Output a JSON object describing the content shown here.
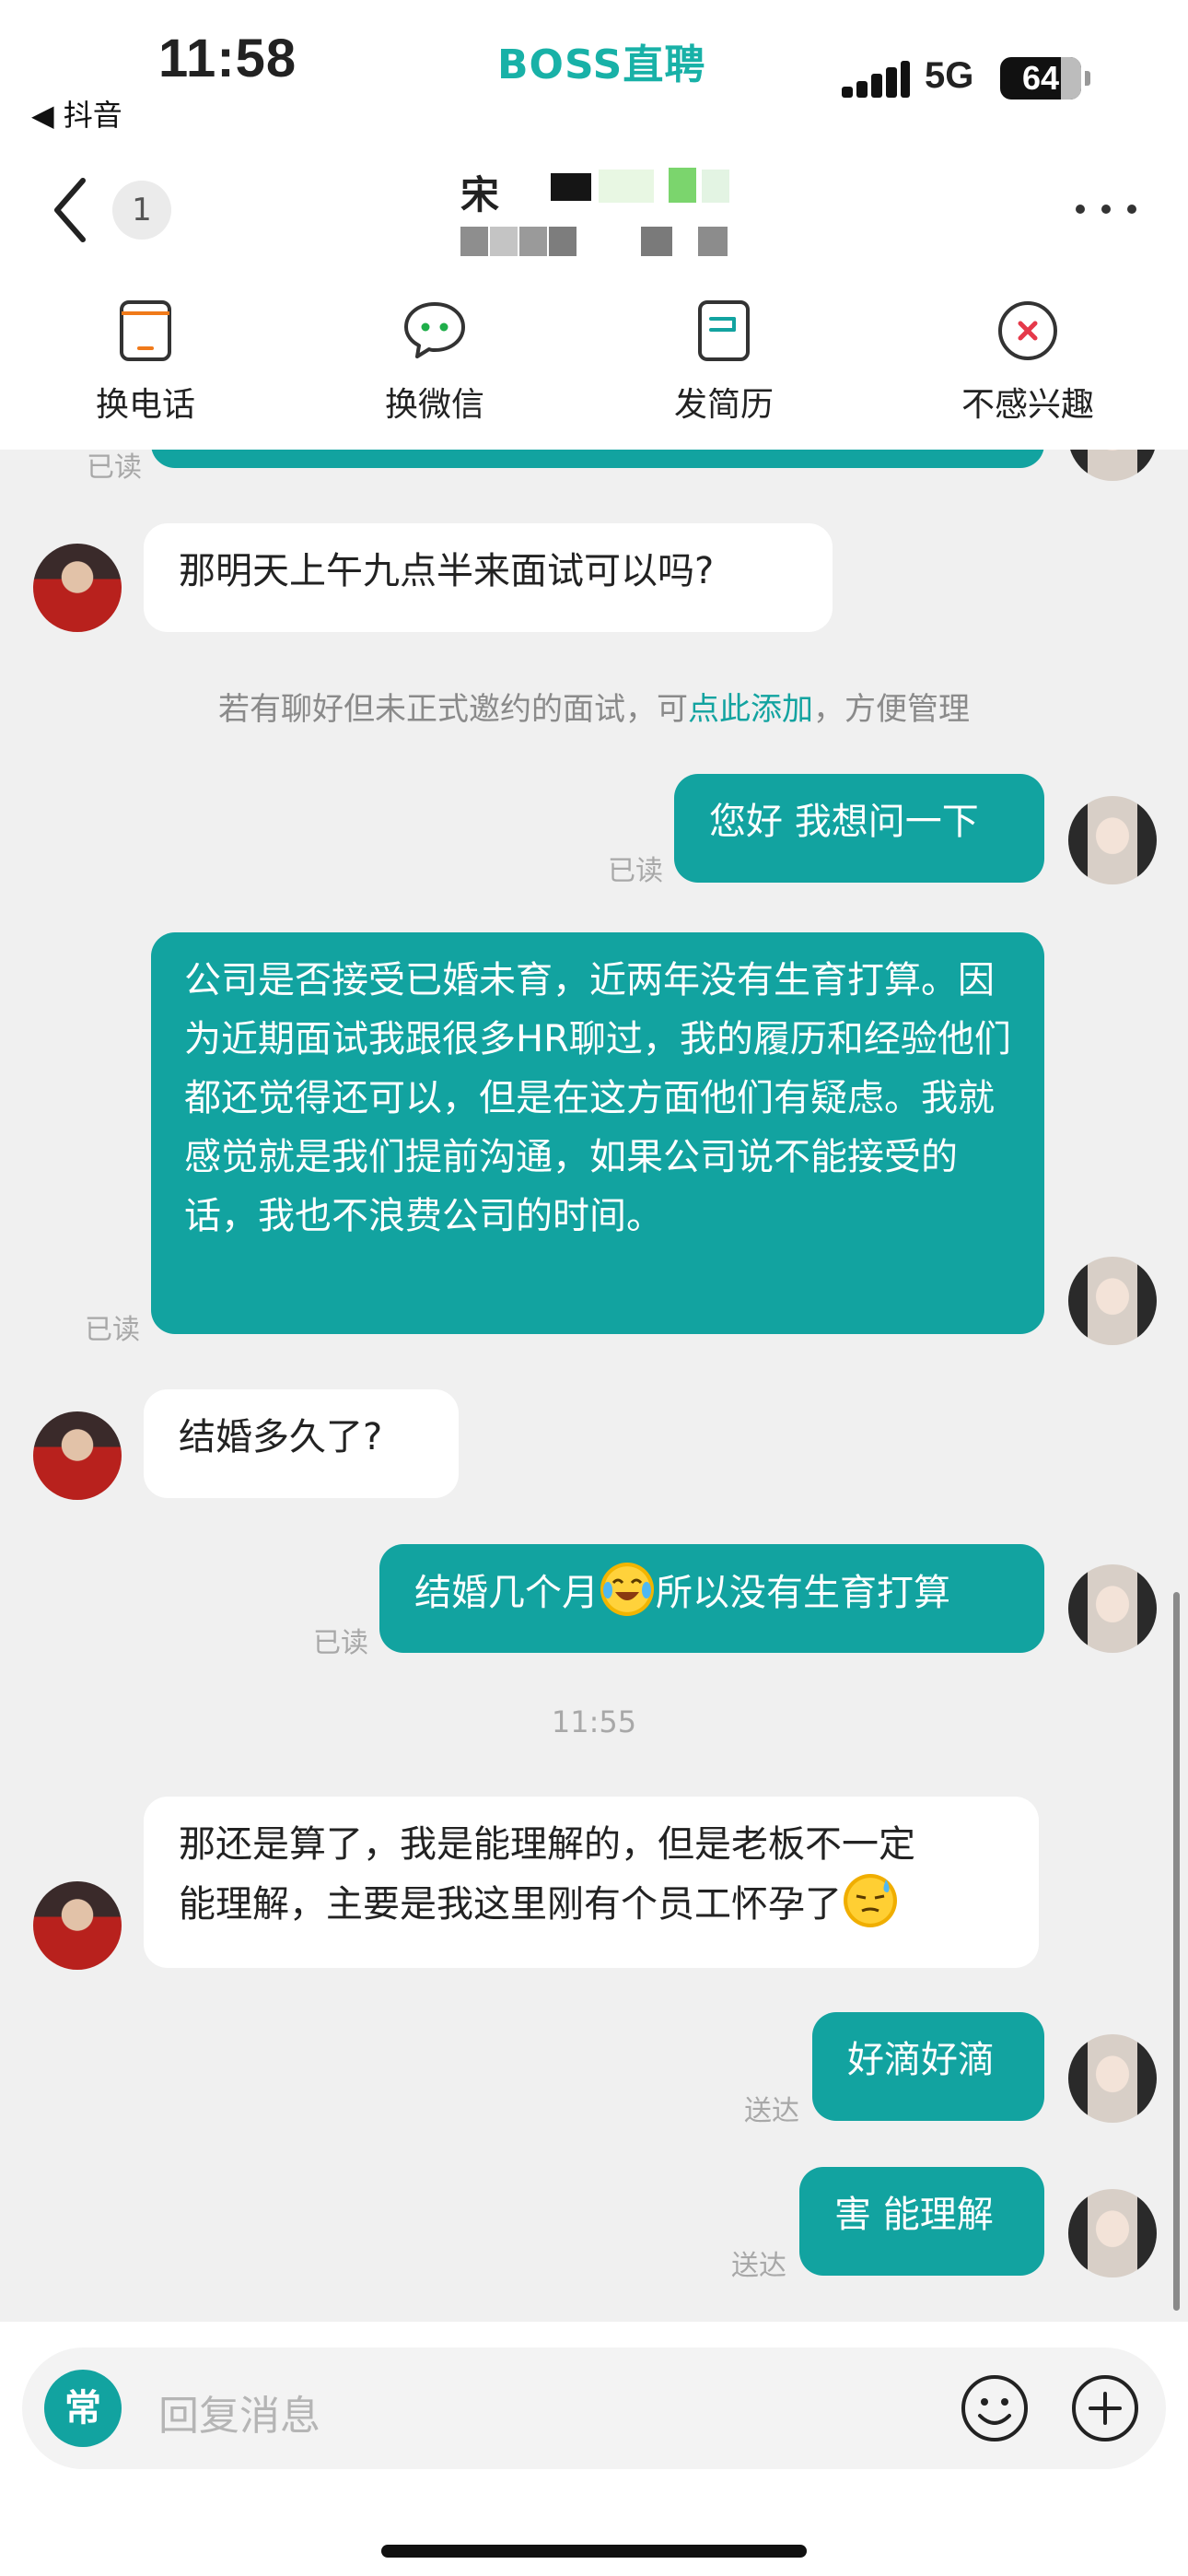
{
  "status_bar": {
    "time": "11:58",
    "back_app": "◀ 抖音",
    "app_logo": "BOSS直聘",
    "network": "5G",
    "battery": "64"
  },
  "header": {
    "unread_count": "1",
    "title_visible": "宋"
  },
  "actions": [
    {
      "label": "换电话",
      "icon": "phone-icon"
    },
    {
      "label": "换微信",
      "icon": "wechat-icon"
    },
    {
      "label": "发简历",
      "icon": "resume-icon"
    },
    {
      "label": "不感兴趣",
      "icon": "not-interested-icon"
    }
  ],
  "chat": {
    "top_read_label": "已读",
    "messages": [
      {
        "from": "hr",
        "text": "那明天上午九点半来面试可以吗?"
      },
      {
        "from": "me",
        "text": "您好 我想问一下",
        "status": "已读"
      },
      {
        "from": "me",
        "text": "公司是否接受已婚未育，近两年没有生育打算。因为近期面试我跟很多HR聊过，我的履历和经验他们都还觉得还可以，但是在这方面他们有疑虑。我就感觉就是我们提前沟通，如果公司说不能接受的话，我也不浪费公司的时间。",
        "status": "已读"
      },
      {
        "from": "hr",
        "text": "结婚多久了?"
      },
      {
        "from": "me",
        "text_before_emoji": "结婚几个月",
        "text_after_emoji": "所以没有生育打算",
        "emoji": "crying-laughing-emoji",
        "status": "已读"
      },
      {
        "from": "hr",
        "text_line1": "那还是算了，我是能理解的，但是老板不一定",
        "text_line2": "能理解，主要是我这里刚有个员工怀孕了",
        "emoji": "sweat-smile-emoji"
      },
      {
        "from": "me",
        "text": "好滴好滴",
        "status": "送达"
      },
      {
        "from": "me",
        "text": "害 能理解",
        "status": "送达"
      }
    ],
    "hint": {
      "before": "若有聊好但未正式邀约的面试，可",
      "link": "点此添加",
      "after": "，方便管理"
    },
    "timestamp": "11:55"
  },
  "input": {
    "quick_reply_label": "常",
    "placeholder": "回复消息"
  },
  "colors": {
    "accent": "#12a3a0",
    "brand": "#18b1a7",
    "danger": "#e5394a"
  }
}
